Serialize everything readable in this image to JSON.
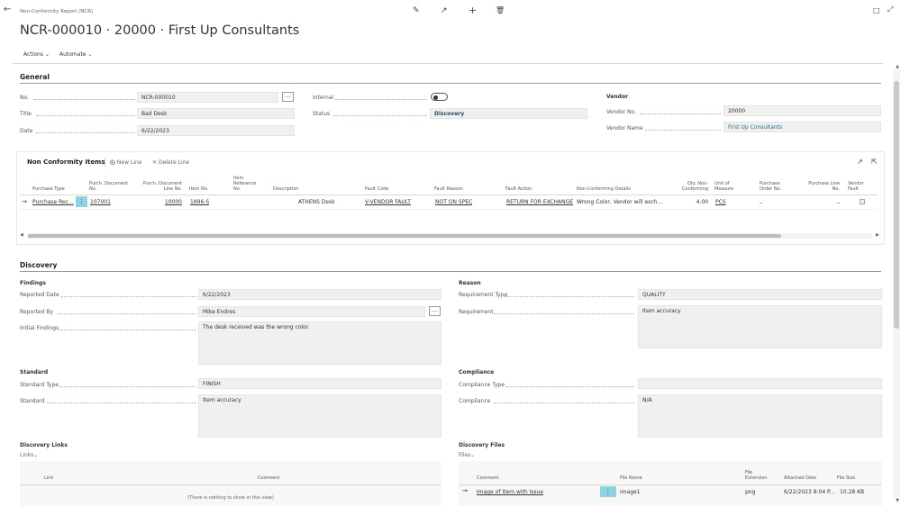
{
  "header": {
    "breadcrumb": "Non-Conformity Report (NCR)",
    "title": "NCR-000010 · 20000 · First Up Consultants",
    "menu": [
      "Actions",
      "Automate"
    ]
  },
  "general": {
    "heading": "General",
    "no": {
      "label": "No.",
      "value": "NCR-000010"
    },
    "title": {
      "label": "Title",
      "value": "Bad Desk"
    },
    "date": {
      "label": "Date",
      "value": "6/22/2023"
    },
    "internal": {
      "label": "Internal"
    },
    "status": {
      "label": "Status",
      "value": "Discovery"
    },
    "vendor_heading": "Vendor",
    "vendor_no": {
      "label": "Vendor No.",
      "value": "20000"
    },
    "vendor_name": {
      "label": "Vendor Name",
      "value": "First Up Consultants"
    }
  },
  "items": {
    "heading": "Non Conformity Items",
    "new_line": "New Line",
    "delete_line": "Delete Line",
    "columns": [
      "Purchase Type",
      "Purch. Document No.",
      "Purch. Document Line No.",
      "Item No.",
      "Item Reference No.",
      "Description",
      "Fault Code",
      "Fault Reason",
      "Fault Action",
      "Non-Conforming Details",
      "Qty. Non-Conforming",
      "Unit of Measure",
      "Purchase Order No.",
      "Purchase Line No.",
      "Vendor Fault"
    ],
    "rows": [
      {
        "purchase_type": "Purchase Rec...",
        "doc_no": "107001",
        "line_no": "10000",
        "item_no": "1896-S",
        "description": "ATHENS Desk",
        "fault_code": "V-VENDOR FAULT",
        "fault_reason": "NOT ON SPEC",
        "fault_action": "RETURN FOR EXCHANGE",
        "details": "Wrong Color, Vendor will exch...",
        "qty": "4.00",
        "uom": "PCS",
        "po_no": "_",
        "po_line": "_"
      }
    ]
  },
  "discovery": {
    "heading": "Discovery",
    "findings_heading": "Findings",
    "reported_date": {
      "label": "Reported Date",
      "value": "6/22/2023"
    },
    "reported_by": {
      "label": "Reported By",
      "value": "Mike Endres"
    },
    "initial_findings": {
      "label": "Initial Findings",
      "value": "The desk received was the wrong color."
    },
    "reason_heading": "Reason",
    "requirement_type": {
      "label": "Requirement Type",
      "value": "QUALITY"
    },
    "requirement": {
      "label": "Requirement",
      "value": "Item accuracy"
    },
    "standard_heading": "Standard",
    "standard_type": {
      "label": "Standard Type",
      "value": "FINISH"
    },
    "standard": {
      "label": "Standard",
      "value": "Item accuracy"
    },
    "compliance_heading": "Compliance",
    "compliance_type": {
      "label": "Compliance Type",
      "value": ""
    },
    "compliance": {
      "label": "Compliance",
      "value": "N/A"
    },
    "links_heading": "Discovery Links",
    "links_menu": "Links",
    "links_columns": [
      "Link",
      "Comment"
    ],
    "links_empty": "(There is nothing to show in this view)",
    "files_heading": "Discovery Files",
    "files_menu": "Files",
    "files_columns": [
      "Comment",
      "File Name",
      "File Extension",
      "Attached Date",
      "File Size"
    ],
    "files_rows": [
      {
        "comment": "Image of Item with Issue",
        "file_name": "image1",
        "ext": "png",
        "date": "6/22/2023 8:04 P...",
        "size": "10.28 KB"
      }
    ]
  }
}
